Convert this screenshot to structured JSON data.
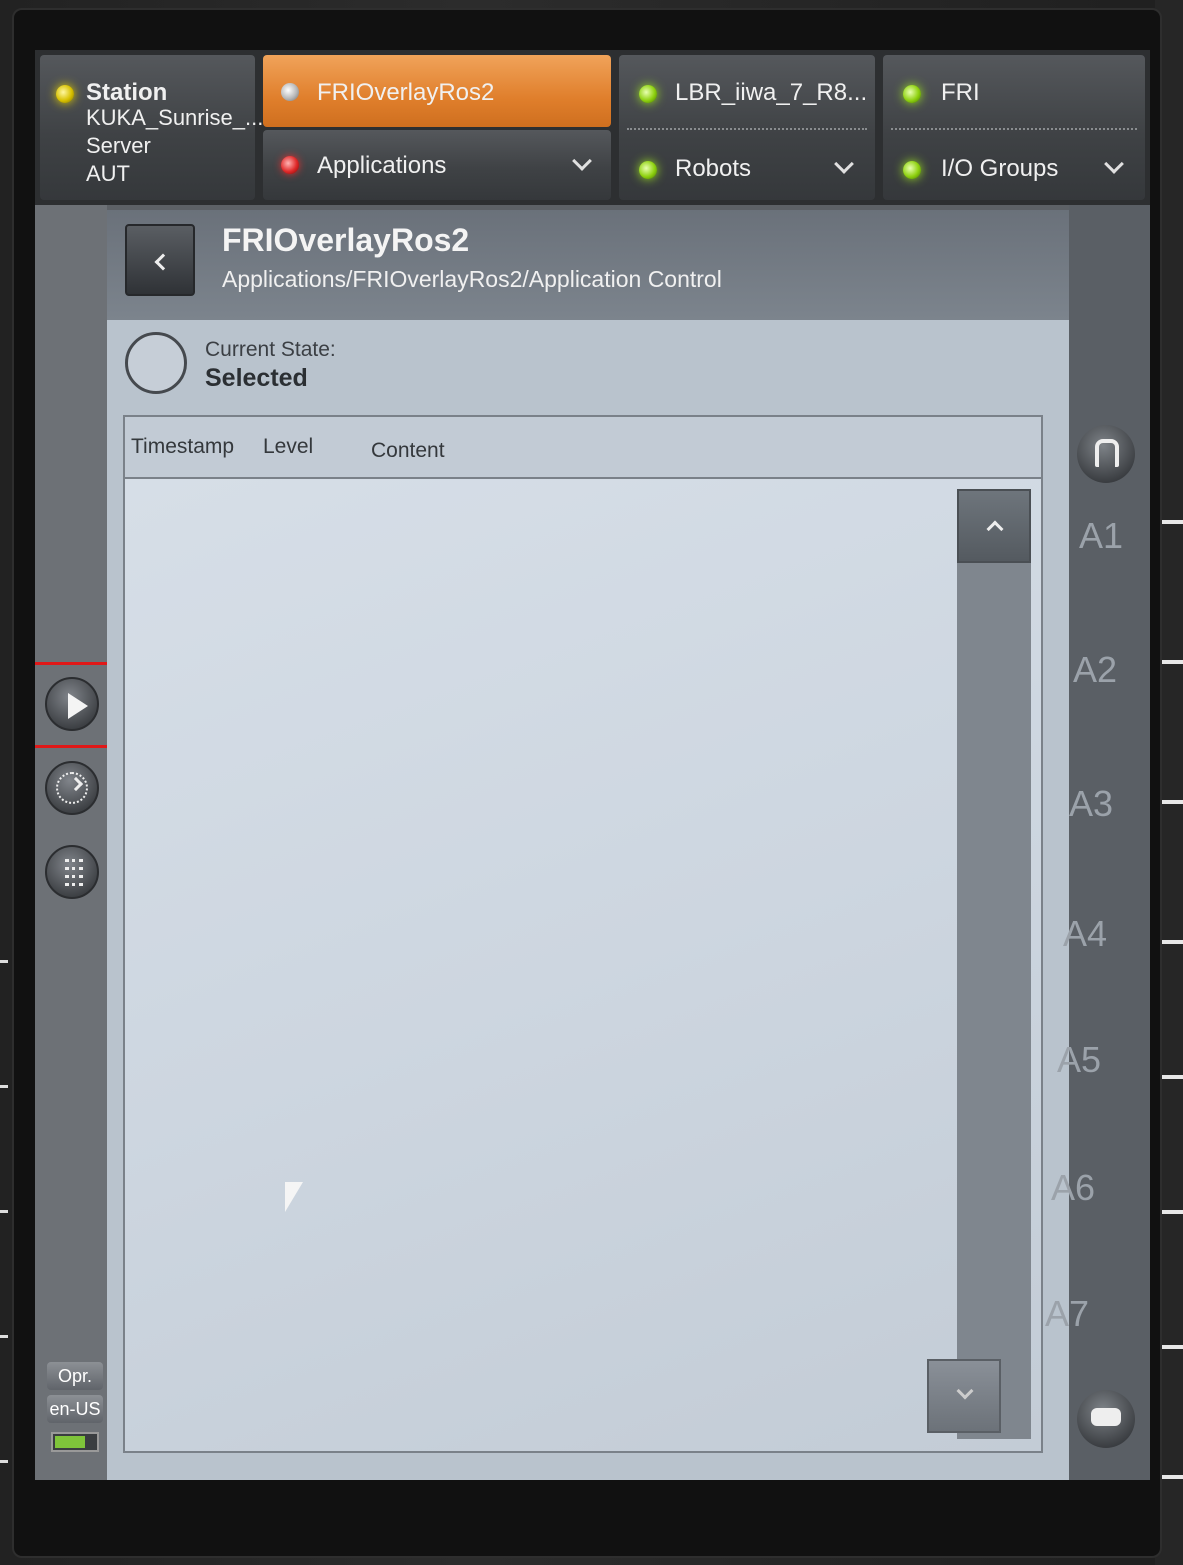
{
  "tabs": {
    "station": {
      "label": "Station",
      "line1": "KUKA_Sunrise_...",
      "line2": "Server",
      "line3": "AUT"
    },
    "app": {
      "label": "FRIOverlayRos2"
    },
    "applications": {
      "label": "Applications"
    },
    "robot": {
      "label": "LBR_iiwa_7_R8..."
    },
    "robots": {
      "label": "Robots"
    },
    "fri": {
      "label": "FRI"
    },
    "io_groups": {
      "label": "I/O Groups"
    }
  },
  "header": {
    "title": "FRIOverlayRos2",
    "breadcrumb": "Applications/FRIOverlayRos2/Application Control"
  },
  "state": {
    "label": "Current State:",
    "value": "Selected"
  },
  "log": {
    "columns": [
      "Timestamp",
      "Level",
      "Content"
    ],
    "rows": []
  },
  "sidebar": {
    "play_icon": "play-icon",
    "clock_icon": "clock-icon",
    "list_icon": "list-icon",
    "operator_mode": "Opr.",
    "language": "en-US"
  },
  "axes": [
    "A1",
    "A2",
    "A3",
    "A4",
    "A5",
    "A6",
    "A7"
  ]
}
